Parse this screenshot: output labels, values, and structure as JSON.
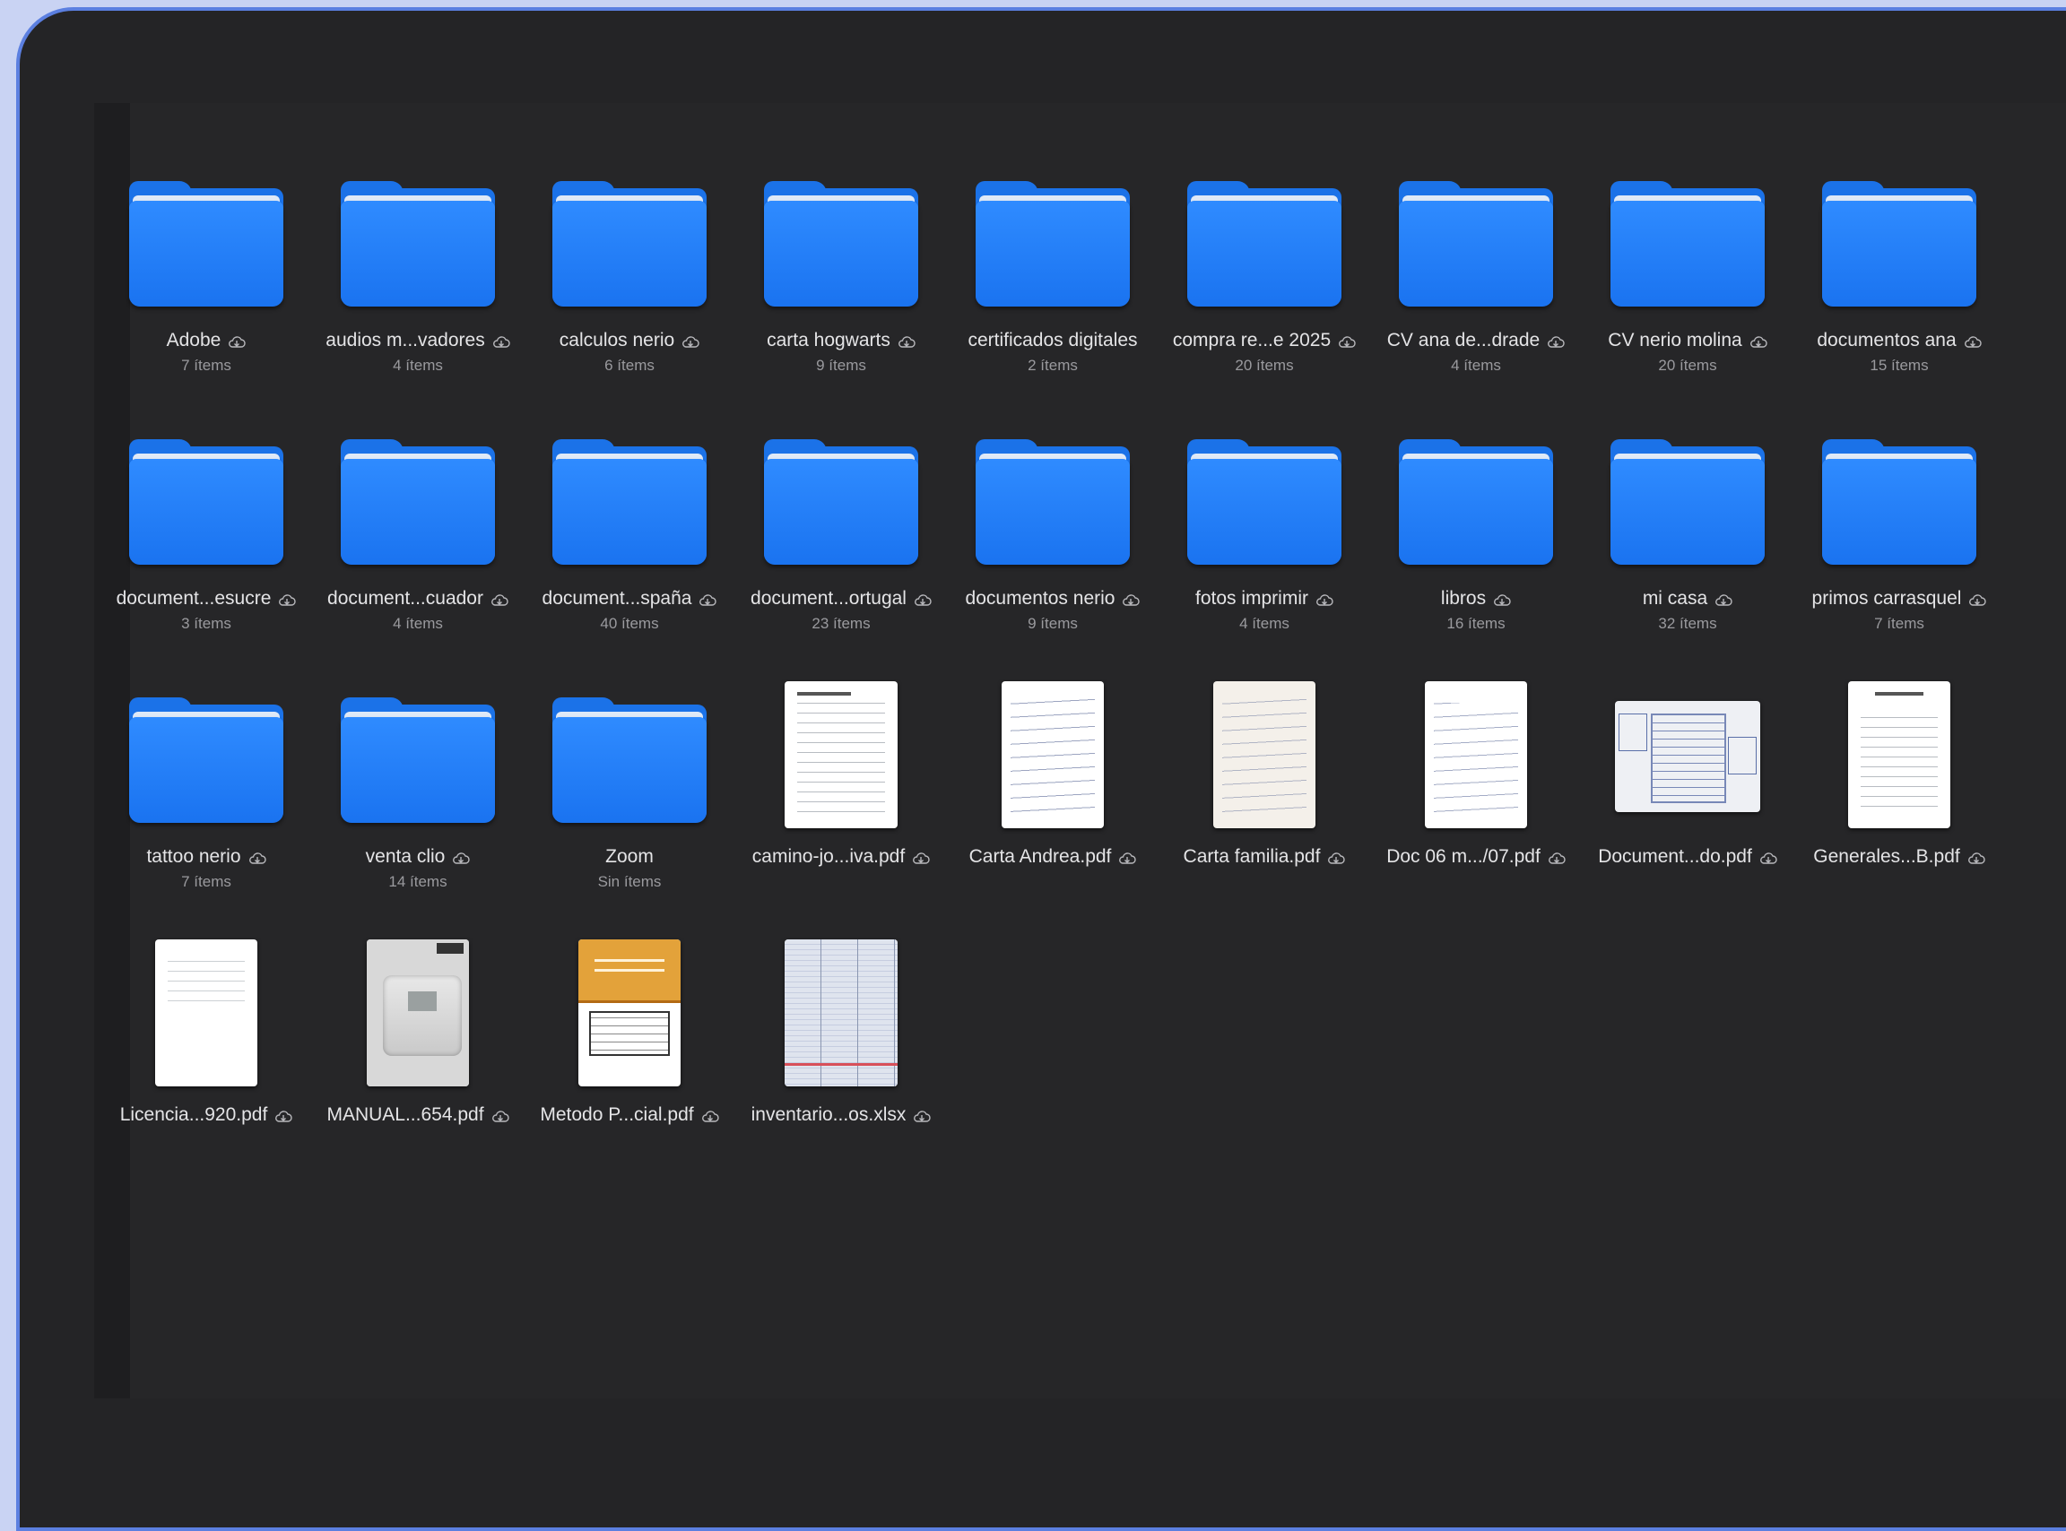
{
  "colors": {
    "folder": "#1b72e8",
    "background": "#242426",
    "window_border": "#5b7fe0"
  },
  "items": [
    {
      "name": "Adobe",
      "count": "7 ítems",
      "type": "folder",
      "cloud": true
    },
    {
      "name": "audios m...vadores",
      "count": "4 ítems",
      "type": "folder",
      "cloud": true
    },
    {
      "name": "calculos nerio",
      "count": "6 ítems",
      "type": "folder",
      "cloud": true
    },
    {
      "name": "carta hogwarts",
      "count": "9 ítems",
      "type": "folder",
      "cloud": true
    },
    {
      "name": "certificados digitales",
      "count": "2 ítems",
      "type": "folder",
      "cloud": false
    },
    {
      "name": "compra re...e 2025",
      "count": "20 ítems",
      "type": "folder",
      "cloud": true
    },
    {
      "name": "CV ana de...drade",
      "count": "4 ítems",
      "type": "folder",
      "cloud": true
    },
    {
      "name": "CV nerio molina",
      "count": "20 ítems",
      "type": "folder",
      "cloud": true
    },
    {
      "name": "documentos ana",
      "count": "15 ítems",
      "type": "folder",
      "cloud": true
    },
    {
      "name": "document...esucre",
      "count": "3 ítems",
      "type": "folder",
      "cloud": true
    },
    {
      "name": "document...cuador",
      "count": "4 ítems",
      "type": "folder",
      "cloud": true
    },
    {
      "name": "document...spaña",
      "count": "40 ítems",
      "type": "folder",
      "cloud": true
    },
    {
      "name": "document...ortugal",
      "count": "23 ítems",
      "type": "folder",
      "cloud": true
    },
    {
      "name": "documentos nerio",
      "count": "9 ítems",
      "type": "folder",
      "cloud": true
    },
    {
      "name": "fotos imprimir",
      "count": "4 ítems",
      "type": "folder",
      "cloud": true
    },
    {
      "name": "libros",
      "count": "16 ítems",
      "type": "folder",
      "cloud": true
    },
    {
      "name": "mi casa",
      "count": "32 ítems",
      "type": "folder",
      "cloud": true
    },
    {
      "name": "primos carrasquel",
      "count": "7 ítems",
      "type": "folder",
      "cloud": true
    },
    {
      "name": "tattoo nerio",
      "count": "7 ítems",
      "type": "folder",
      "cloud": true
    },
    {
      "name": "venta clio",
      "count": "14 ítems",
      "type": "folder",
      "cloud": true
    },
    {
      "name": "Zoom",
      "count": "Sin ítems",
      "type": "folder",
      "cloud": false
    },
    {
      "name": "camino-jo...iva.pdf",
      "count": "",
      "type": "doc-text",
      "cloud": true
    },
    {
      "name": "Carta Andrea.pdf",
      "count": "",
      "type": "doc-hand",
      "cloud": true
    },
    {
      "name": "Carta familia.pdf",
      "count": "",
      "type": "doc-cream",
      "cloud": true
    },
    {
      "name": "Doc 06 m.../07.pdf",
      "count": "",
      "type": "doc-hand2",
      "cloud": true
    },
    {
      "name": "Document...do.pdf",
      "count": "",
      "type": "doc-landscape",
      "cloud": true
    },
    {
      "name": "Generales...B.pdf",
      "count": "",
      "type": "doc-form",
      "cloud": true
    },
    {
      "name": "Licencia...920.pdf",
      "count": "",
      "type": "doc-sparse",
      "cloud": true
    },
    {
      "name": "MANUAL...654.pdf",
      "count": "",
      "type": "doc-manual",
      "cloud": true
    },
    {
      "name": "Metodo P...cial.pdf",
      "count": "",
      "type": "doc-orange",
      "cloud": true
    },
    {
      "name": "inventario...os.xlsx",
      "count": "",
      "type": "doc-sheet",
      "cloud": true
    }
  ]
}
